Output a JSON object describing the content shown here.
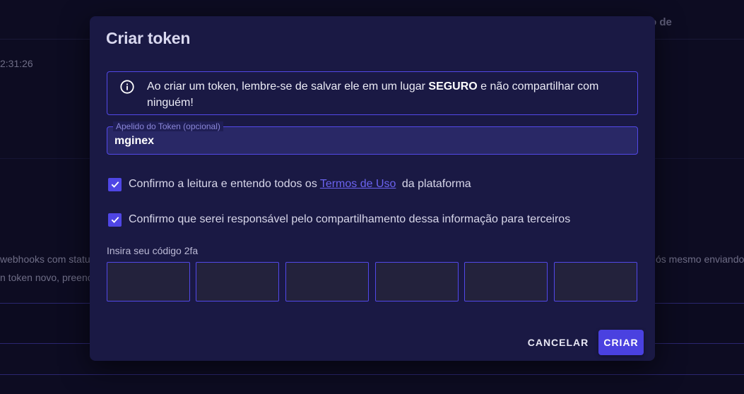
{
  "background": {
    "header_partial": "o de",
    "time_partial": "2:31:26",
    "desc_line1_left": "webhooks com statu",
    "desc_line1_right": "ós mesmo enviando",
    "desc_line2_left": "n token novo, preenc"
  },
  "modal": {
    "title": "Criar token",
    "info": {
      "icon": "info-icon",
      "text_before": "Ao criar um token, lembre-se de salvar ele em um lugar ",
      "text_bold": "SEGURO",
      "text_after": " e não compartilhar com ninguém!"
    },
    "nickname_field": {
      "label": "Apelido do Token (opcional)",
      "value": "mginex"
    },
    "checkboxes": [
      {
        "checked": true,
        "text_before": "Confirmo a leitura e entendo todos os",
        "link_text": "Termos de Uso",
        "text_after": " da plataforma"
      },
      {
        "checked": true,
        "text": "Confirmo que serei responsável pelo compartilhamento dessa informação para terceiros"
      }
    ],
    "twofa": {
      "label": "Insira seu código 2fa",
      "digits": [
        "",
        "",
        "",
        "",
        "",
        ""
      ]
    },
    "actions": {
      "cancel": "CANCELAR",
      "create": "CRIAR"
    }
  },
  "colors": {
    "accent": "#4f46e5",
    "modal_bg": "#1a1944",
    "page_bg": "#0d0c22"
  }
}
